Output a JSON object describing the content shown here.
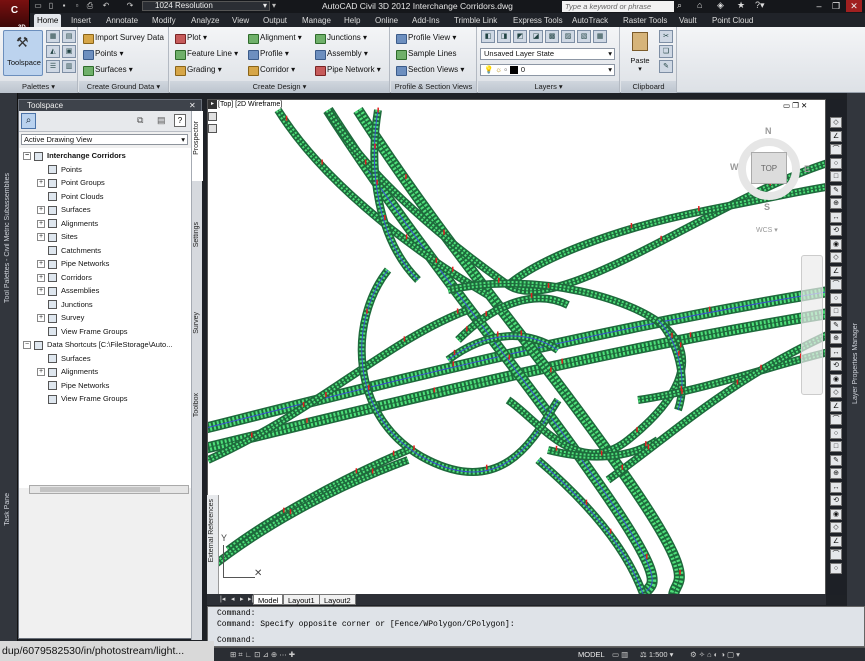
{
  "window": {
    "app_title": "AutoCAD Civil 3D 2012   Interchange Corridors.dwg",
    "workspace": "1024 Resolution",
    "search_placeholder": "Type a keyword or phrase",
    "app_badge": "3D"
  },
  "tabs": [
    "Home",
    "Insert",
    "Annotate",
    "Modify",
    "Analyze",
    "View",
    "Output",
    "Manage",
    "Help",
    "Online",
    "Add-Ins",
    "Trimble Link",
    "Express Tools",
    "AutoTrack",
    "Raster Tools",
    "Vault",
    "Point Cloud"
  ],
  "ribbon": {
    "palettes": {
      "title": "Palettes",
      "toolspace": "Toolspace"
    },
    "ground": {
      "title": "Create Ground Data",
      "import": "Import Survey Data",
      "points": "Points",
      "surfaces": "Surfaces"
    },
    "design": {
      "title": "Create Design",
      "plot": "Plot",
      "feature_line": "Feature Line",
      "grading": "Grading",
      "alignment": "Alignment",
      "profile": "Profile",
      "corridor": "Corridor",
      "junctions": "Junctions",
      "assembly": "Assembly",
      "pipe_network": "Pipe Network"
    },
    "profile": {
      "title": "Profile & Section Views",
      "profile_view": "Profile View",
      "sample_lines": "Sample Lines",
      "section_views": "Section Views"
    },
    "layers": {
      "title": "Layers",
      "layer_state": "Unsaved Layer State",
      "current_layer": "0"
    },
    "clipboard": {
      "title": "Clipboard",
      "paste": "Paste"
    }
  },
  "left_strip": {
    "tool_palettes": "Tool Palettes - Civil Metric Subassemblies",
    "task_pane": "Task Pane"
  },
  "toolspace": {
    "title": "Toolspace",
    "view": "Active Drawing View",
    "tree": [
      {
        "label": "Interchange Corridors",
        "level": 0,
        "bold": true,
        "exp": "−"
      },
      {
        "label": "Points",
        "level": 1,
        "exp": ""
      },
      {
        "label": "Point Groups",
        "level": 1,
        "exp": "+"
      },
      {
        "label": "Point Clouds",
        "level": 1,
        "exp": ""
      },
      {
        "label": "Surfaces",
        "level": 1,
        "exp": "+"
      },
      {
        "label": "Alignments",
        "level": 1,
        "exp": "+"
      },
      {
        "label": "Sites",
        "level": 1,
        "exp": "+"
      },
      {
        "label": "Catchments",
        "level": 1,
        "exp": ""
      },
      {
        "label": "Pipe Networks",
        "level": 1,
        "exp": "+"
      },
      {
        "label": "Corridors",
        "level": 1,
        "exp": "+"
      },
      {
        "label": "Assemblies",
        "level": 1,
        "exp": "+"
      },
      {
        "label": "Junctions",
        "level": 1,
        "exp": ""
      },
      {
        "label": "Survey",
        "level": 1,
        "exp": "+"
      },
      {
        "label": "View Frame Groups",
        "level": 1,
        "exp": ""
      },
      {
        "label": "Data Shortcuts [C:\\FileStorage\\Auto...",
        "level": 0,
        "bold": false,
        "exp": "−"
      },
      {
        "label": "Surfaces",
        "level": 1,
        "exp": ""
      },
      {
        "label": "Alignments",
        "level": 1,
        "exp": "+"
      },
      {
        "label": "Pipe Networks",
        "level": 1,
        "exp": ""
      },
      {
        "label": "View Frame Groups",
        "level": 1,
        "exp": ""
      }
    ],
    "side_tabs": [
      "Prospector",
      "Settings",
      "Survey",
      "Toolbox"
    ]
  },
  "viewport": {
    "label": "[Top] [2D Wireframe]",
    "compass": {
      "n": "N",
      "s": "S",
      "e": "E",
      "w": "W",
      "top": "TOP",
      "wcs": "WCS"
    },
    "ucs_y": "Y",
    "ext_refs": "External References"
  },
  "right_strip": {
    "layer_props": "Layer Properties Manager"
  },
  "layout_tabs": [
    "Model",
    "Layout1",
    "Layout2"
  ],
  "command": {
    "line1": "Command:",
    "line2": "Command: Specify opposite corner or [Fence/WPolygon/CPolygon]:",
    "prompt": "Command:"
  },
  "status": {
    "model": "MODEL",
    "scale": "1:500"
  },
  "url_overlay": "dup/6079582530/in/photostream/light...",
  "colors": {
    "road_dark": "#1e6a3c",
    "road_light": "#4fe07a",
    "road_blue": "#3a4fd0",
    "marker_red": "#e02020"
  }
}
